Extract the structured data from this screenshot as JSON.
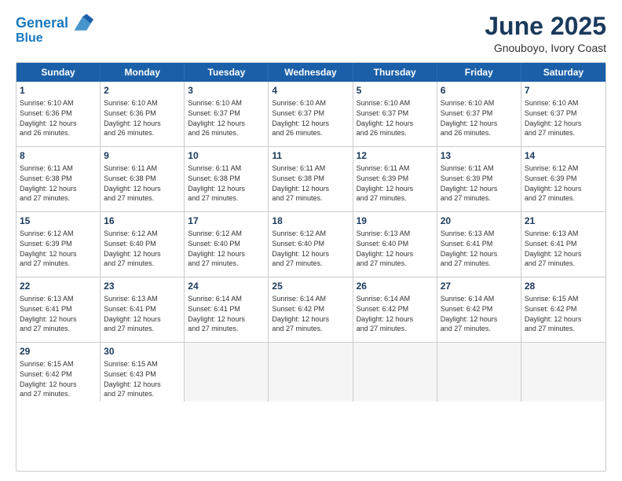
{
  "logo": {
    "line1": "General",
    "line2": "Blue"
  },
  "title": "June 2025",
  "subtitle": "Gnouboyo, Ivory Coast",
  "header_days": [
    "Sunday",
    "Monday",
    "Tuesday",
    "Wednesday",
    "Thursday",
    "Friday",
    "Saturday"
  ],
  "rows": [
    [
      {
        "day": "1",
        "info": "Sunrise: 6:10 AM\nSunset: 6:36 PM\nDaylight: 12 hours\nand 26 minutes."
      },
      {
        "day": "2",
        "info": "Sunrise: 6:10 AM\nSunset: 6:36 PM\nDaylight: 12 hours\nand 26 minutes."
      },
      {
        "day": "3",
        "info": "Sunrise: 6:10 AM\nSunset: 6:37 PM\nDaylight: 12 hours\nand 26 minutes."
      },
      {
        "day": "4",
        "info": "Sunrise: 6:10 AM\nSunset: 6:37 PM\nDaylight: 12 hours\nand 26 minutes."
      },
      {
        "day": "5",
        "info": "Sunrise: 6:10 AM\nSunset: 6:37 PM\nDaylight: 12 hours\nand 26 minutes."
      },
      {
        "day": "6",
        "info": "Sunrise: 6:10 AM\nSunset: 6:37 PM\nDaylight: 12 hours\nand 26 minutes."
      },
      {
        "day": "7",
        "info": "Sunrise: 6:10 AM\nSunset: 6:37 PM\nDaylight: 12 hours\nand 27 minutes."
      }
    ],
    [
      {
        "day": "8",
        "info": "Sunrise: 6:11 AM\nSunset: 6:38 PM\nDaylight: 12 hours\nand 27 minutes."
      },
      {
        "day": "9",
        "info": "Sunrise: 6:11 AM\nSunset: 6:38 PM\nDaylight: 12 hours\nand 27 minutes."
      },
      {
        "day": "10",
        "info": "Sunrise: 6:11 AM\nSunset: 6:38 PM\nDaylight: 12 hours\nand 27 minutes."
      },
      {
        "day": "11",
        "info": "Sunrise: 6:11 AM\nSunset: 6:38 PM\nDaylight: 12 hours\nand 27 minutes."
      },
      {
        "day": "12",
        "info": "Sunrise: 6:11 AM\nSunset: 6:39 PM\nDaylight: 12 hours\nand 27 minutes."
      },
      {
        "day": "13",
        "info": "Sunrise: 6:11 AM\nSunset: 6:39 PM\nDaylight: 12 hours\nand 27 minutes."
      },
      {
        "day": "14",
        "info": "Sunrise: 6:12 AM\nSunset: 6:39 PM\nDaylight: 12 hours\nand 27 minutes."
      }
    ],
    [
      {
        "day": "15",
        "info": "Sunrise: 6:12 AM\nSunset: 6:39 PM\nDaylight: 12 hours\nand 27 minutes."
      },
      {
        "day": "16",
        "info": "Sunrise: 6:12 AM\nSunset: 6:40 PM\nDaylight: 12 hours\nand 27 minutes."
      },
      {
        "day": "17",
        "info": "Sunrise: 6:12 AM\nSunset: 6:40 PM\nDaylight: 12 hours\nand 27 minutes."
      },
      {
        "day": "18",
        "info": "Sunrise: 6:12 AM\nSunset: 6:40 PM\nDaylight: 12 hours\nand 27 minutes."
      },
      {
        "day": "19",
        "info": "Sunrise: 6:13 AM\nSunset: 6:40 PM\nDaylight: 12 hours\nand 27 minutes."
      },
      {
        "day": "20",
        "info": "Sunrise: 6:13 AM\nSunset: 6:41 PM\nDaylight: 12 hours\nand 27 minutes."
      },
      {
        "day": "21",
        "info": "Sunrise: 6:13 AM\nSunset: 6:41 PM\nDaylight: 12 hours\nand 27 minutes."
      }
    ],
    [
      {
        "day": "22",
        "info": "Sunrise: 6:13 AM\nSunset: 6:41 PM\nDaylight: 12 hours\nand 27 minutes."
      },
      {
        "day": "23",
        "info": "Sunrise: 6:13 AM\nSunset: 6:41 PM\nDaylight: 12 hours\nand 27 minutes."
      },
      {
        "day": "24",
        "info": "Sunrise: 6:14 AM\nSunset: 6:41 PM\nDaylight: 12 hours\nand 27 minutes."
      },
      {
        "day": "25",
        "info": "Sunrise: 6:14 AM\nSunset: 6:42 PM\nDaylight: 12 hours\nand 27 minutes."
      },
      {
        "day": "26",
        "info": "Sunrise: 6:14 AM\nSunset: 6:42 PM\nDaylight: 12 hours\nand 27 minutes."
      },
      {
        "day": "27",
        "info": "Sunrise: 6:14 AM\nSunset: 6:42 PM\nDaylight: 12 hours\nand 27 minutes."
      },
      {
        "day": "28",
        "info": "Sunrise: 6:15 AM\nSunset: 6:42 PM\nDaylight: 12 hours\nand 27 minutes."
      }
    ],
    [
      {
        "day": "29",
        "info": "Sunrise: 6:15 AM\nSunset: 6:42 PM\nDaylight: 12 hours\nand 27 minutes."
      },
      {
        "day": "30",
        "info": "Sunrise: 6:15 AM\nSunset: 6:43 PM\nDaylight: 12 hours\nand 27 minutes."
      },
      {
        "day": "",
        "info": ""
      },
      {
        "day": "",
        "info": ""
      },
      {
        "day": "",
        "info": ""
      },
      {
        "day": "",
        "info": ""
      },
      {
        "day": "",
        "info": ""
      }
    ]
  ]
}
